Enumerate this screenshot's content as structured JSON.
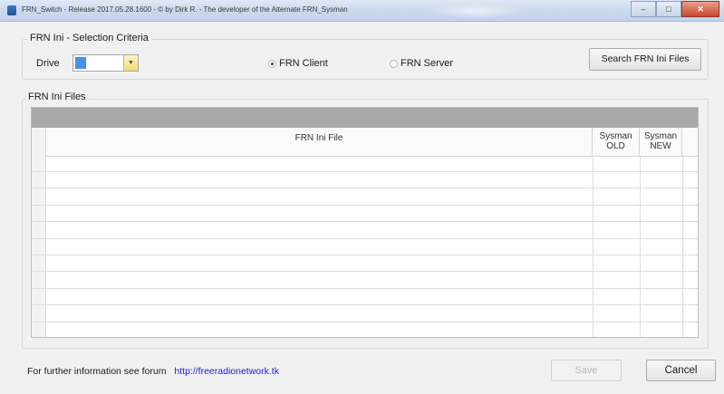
{
  "window": {
    "title": "FRN_Switch - Release 2017.05.28.1600 - © by Dirk R. - The developer of the Alternate FRN_Sysman",
    "controls": [
      "minimize-icon",
      "maximize-icon",
      "close-icon"
    ]
  },
  "selection": {
    "group_label": "FRN Ini - Selection Criteria",
    "drive_label": "Drive",
    "drive_value": "",
    "radio_client": "FRN Client",
    "radio_server": "FRN Server",
    "selected_radio": "FRN Client",
    "search_button": "Search FRN Ini Files"
  },
  "files": {
    "group_label": "FRN Ini Files",
    "columns": [
      {
        "label": "FRN Ini File"
      },
      {
        "label": "Sysman\nOLD"
      },
      {
        "label": "Sysman\nNEW"
      }
    ],
    "rows": []
  },
  "footer": {
    "info_text": "For further information see forum",
    "link_text": "http://freeradionetwork.tk",
    "save_label": "Save",
    "cancel_label": "Cancel"
  },
  "colors": {
    "link": "#2323c8",
    "grid_band": "#a9a9a9",
    "drive_highlight": "#4a90e2"
  }
}
